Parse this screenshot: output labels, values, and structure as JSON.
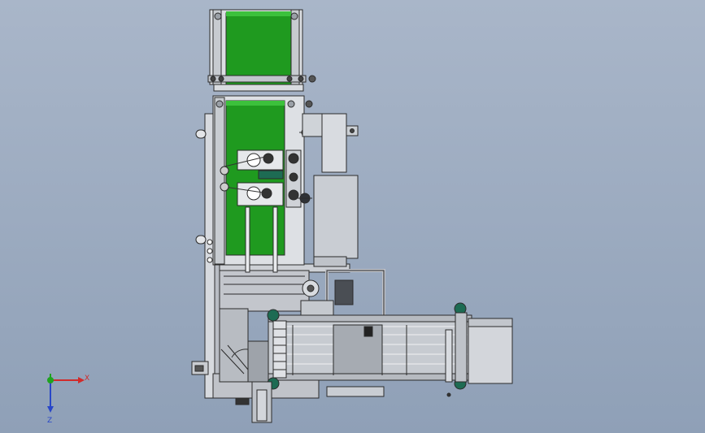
{
  "viewport": {
    "background_top": "#a9b6c9",
    "background_bottom": "#8fa0b7"
  },
  "colors": {
    "belt": "#1f9a1f",
    "frame": "#d7dadf",
    "frame_shade": "#b9bdc4",
    "steel": "#8d9299",
    "outline": "#2b2b2b",
    "roller_green": "#1d6b53",
    "dark_part": "#3a3d42",
    "axis_x": "#d12a2a",
    "axis_y": "#1fa31f",
    "axis_z": "#2846c8"
  },
  "triad": {
    "x_label": "X",
    "z_label": "Z"
  },
  "model": {
    "view": "front",
    "components": [
      "upper-green-conveyor",
      "lower-green-conveyor",
      "main-frame",
      "motor-housing-upper",
      "motor-housing-lower",
      "adjustment-knob-left",
      "adjustment-knob-right",
      "horizontal-conveyor",
      "end-cover-box",
      "base-post"
    ]
  }
}
